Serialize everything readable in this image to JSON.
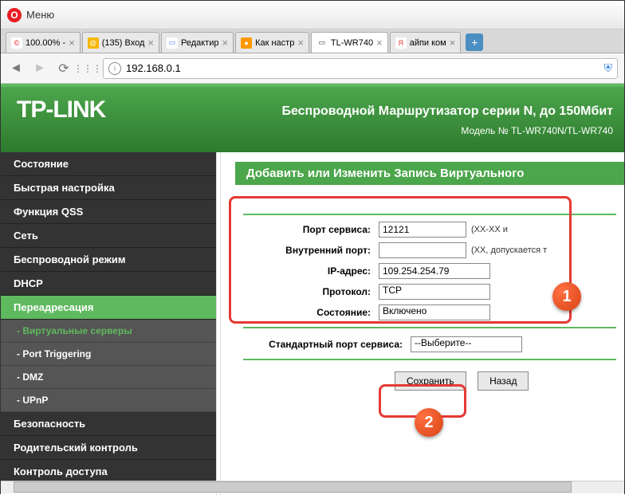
{
  "browser": {
    "menu_label": "Меню",
    "tabs": [
      {
        "label": "100.00% -",
        "icon_bg": "#fff",
        "icon_color": "#e81c23",
        "icon_char": "©"
      },
      {
        "label": "(135) Вход",
        "icon_bg": "#f7b500",
        "icon_color": "#fff",
        "icon_char": "@"
      },
      {
        "label": "Редактир",
        "icon_bg": "#fff",
        "icon_color": "#4285f4",
        "icon_char": "▭"
      },
      {
        "label": "Как настр",
        "icon_bg": "#ff9800",
        "icon_color": "#fff",
        "icon_char": "●"
      },
      {
        "label": "TL-WR740",
        "icon_bg": "#fff",
        "icon_color": "#333",
        "icon_char": "▭",
        "active": true
      },
      {
        "label": "айпи ком",
        "icon_bg": "#fff",
        "icon_color": "#e53935",
        "icon_char": "Я"
      }
    ],
    "url": "192.168.0.1"
  },
  "router": {
    "logo": "TP-LINK",
    "title": "Беспроводной Маршрутизатор серии N, до 150Мбит",
    "model": "Модель № TL-WR740N/TL-WR740",
    "nav": [
      {
        "label": "Состояние",
        "type": "item"
      },
      {
        "label": "Быстрая настройка",
        "type": "item"
      },
      {
        "label": "Функция QSS",
        "type": "item"
      },
      {
        "label": "Сеть",
        "type": "item"
      },
      {
        "label": "Беспроводной режим",
        "type": "item"
      },
      {
        "label": "DHCP",
        "type": "item"
      },
      {
        "label": "Переадресация",
        "type": "item",
        "active": true
      },
      {
        "label": "- Виртуальные серверы",
        "type": "sub",
        "active": true
      },
      {
        "label": "- Port Triggering",
        "type": "sub"
      },
      {
        "label": "- DMZ",
        "type": "sub"
      },
      {
        "label": "- UPnP",
        "type": "sub"
      },
      {
        "label": "Безопасность",
        "type": "item"
      },
      {
        "label": "Родительский контроль",
        "type": "item"
      },
      {
        "label": "Контроль доступа",
        "type": "item"
      }
    ],
    "content_title": "Добавить или Изменить Запись Виртуального",
    "form": {
      "service_port_label": "Порт сервиса:",
      "service_port_value": "12121",
      "service_port_hint": "(XX-XX и",
      "internal_port_label": "Внутренний порт:",
      "internal_port_value": "",
      "internal_port_hint": "(XX, допускается т",
      "ip_label": "IP-адрес:",
      "ip_value": "109.254.254.79",
      "protocol_label": "Протокол:",
      "protocol_value": "TCP",
      "status_label": "Состояние:",
      "status_value": "Включено",
      "common_port_label": "Стандартный порт сервиса:",
      "common_port_value": "--Выберите--",
      "save_btn": "Сохранить",
      "back_btn": "Назад"
    },
    "badges": {
      "one": "1",
      "two": "2"
    }
  }
}
